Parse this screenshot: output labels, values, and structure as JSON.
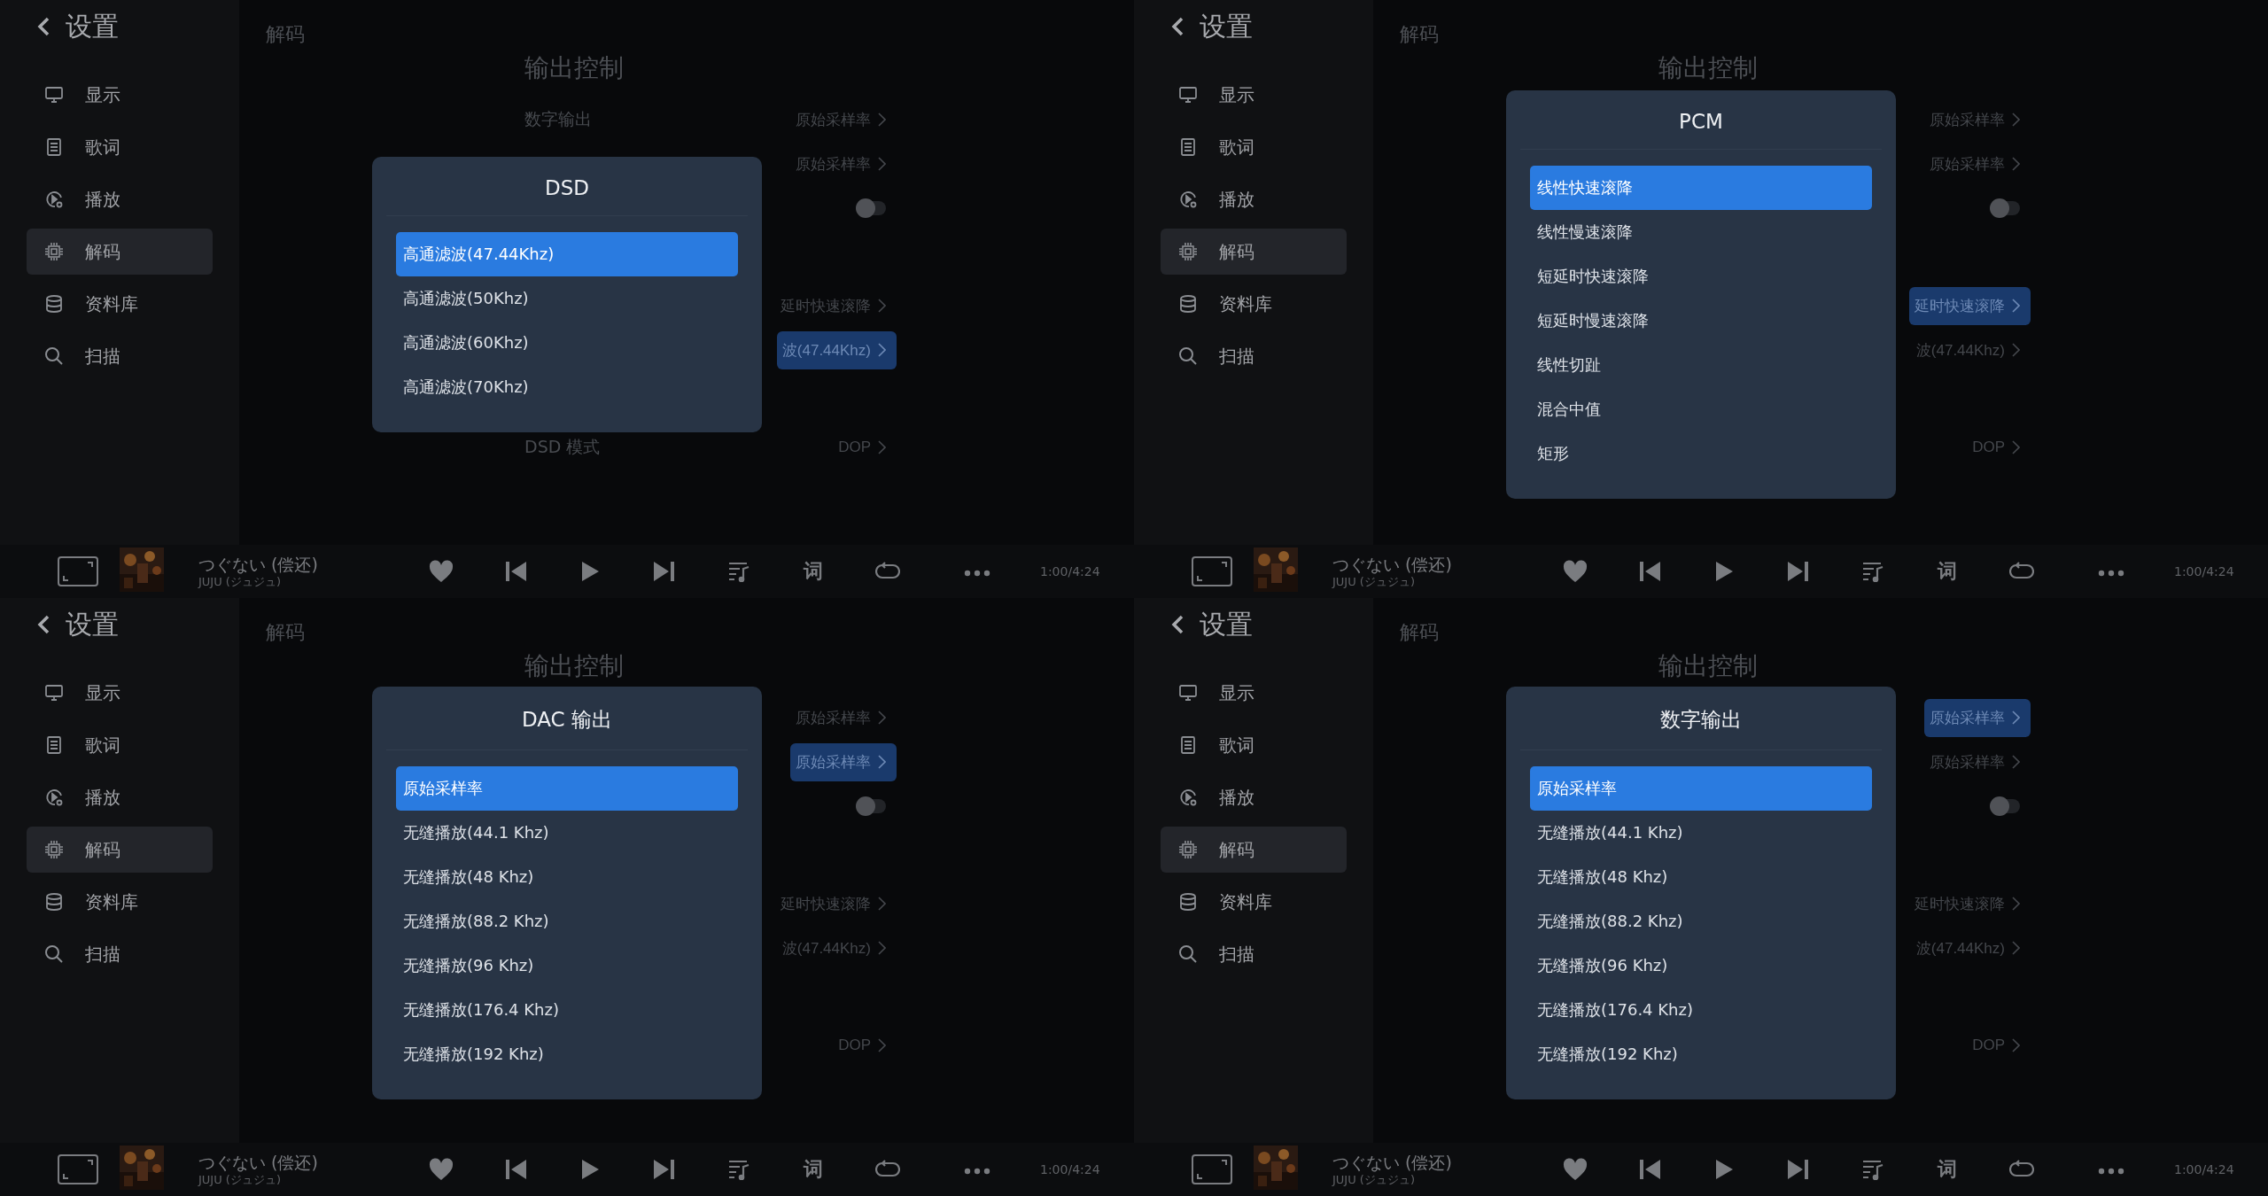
{
  "panels": [
    {
      "sidebar": {
        "title": "设置",
        "items": [
          {
            "label": "显示",
            "selected": false
          },
          {
            "label": "歌词",
            "selected": false
          },
          {
            "label": "播放",
            "selected": false
          },
          {
            "label": "解码",
            "selected": true
          },
          {
            "label": "资料库",
            "selected": false
          },
          {
            "label": "扫描",
            "selected": false
          }
        ]
      },
      "page_title": "解码",
      "section_title": "输出控制",
      "groups": [
        {
          "rows": [
            {
              "kind": "link",
              "label": "数字输出",
              "value": "原始采样率",
              "selected": false
            },
            {
              "kind": "link",
              "value": "原始采样率",
              "selected": false
            },
            {
              "kind": "toggle",
              "on": false,
              "selected": false
            }
          ]
        },
        {
          "rows": [
            {
              "kind": "link",
              "value": "延时快速滚降",
              "selected": false
            },
            {
              "kind": "link",
              "value": "波(47.44Khz)",
              "selected": true
            }
          ]
        },
        {
          "rows": [
            {
              "kind": "link",
              "label": "DSD 模式",
              "value": "DOP",
              "selected": false
            }
          ]
        }
      ],
      "dialog": {
        "title": "DSD",
        "options": [
          {
            "label": "高通滤波(47.44Khz)",
            "selected": true
          },
          {
            "label": "高通滤波(50Khz)",
            "selected": false
          },
          {
            "label": "高通滤波(60Khz)",
            "selected": false
          },
          {
            "label": "高通滤波(70Khz)",
            "selected": false
          }
        ]
      },
      "player": {
        "title": "つぐない (偿还)",
        "artist": "JUJU (ジュジュ)",
        "lyrics_button": "词",
        "time": "1:00/4:24"
      }
    },
    {
      "sidebar": {
        "title": "设置",
        "items": [
          {
            "label": "显示",
            "selected": false
          },
          {
            "label": "歌词",
            "selected": false
          },
          {
            "label": "播放",
            "selected": false
          },
          {
            "label": "解码",
            "selected": true
          },
          {
            "label": "资料库",
            "selected": false
          },
          {
            "label": "扫描",
            "selected": false
          }
        ]
      },
      "page_title": "解码",
      "section_title": "输出控制",
      "groups": [
        {
          "rows": [
            {
              "kind": "link",
              "value": "原始采样率",
              "selected": false
            },
            {
              "kind": "link",
              "value": "原始采样率",
              "selected": false
            },
            {
              "kind": "toggle",
              "on": false,
              "selected": false
            }
          ]
        },
        {
          "rows": [
            {
              "kind": "link",
              "value": "延时快速滚降",
              "selected": true
            },
            {
              "kind": "link",
              "value": "波(47.44Khz)",
              "selected": false
            }
          ]
        },
        {
          "rows": [
            {
              "kind": "link",
              "value": "DOP",
              "selected": false
            }
          ]
        }
      ],
      "dialog": {
        "title": "PCM",
        "options": [
          {
            "label": "线性快速滚降",
            "selected": true
          },
          {
            "label": "线性慢速滚降",
            "selected": false
          },
          {
            "label": "短延时快速滚降",
            "selected": false
          },
          {
            "label": "短延时慢速滚降",
            "selected": false
          },
          {
            "label": "线性切趾",
            "selected": false
          },
          {
            "label": "混合中值",
            "selected": false
          },
          {
            "label": "矩形",
            "selected": false
          }
        ]
      },
      "player": {
        "title": "つぐない (偿还)",
        "artist": "JUJU (ジュジュ)",
        "lyrics_button": "词",
        "time": "1:00/4:24"
      }
    },
    {
      "sidebar": {
        "title": "设置",
        "items": [
          {
            "label": "显示",
            "selected": false
          },
          {
            "label": "歌词",
            "selected": false
          },
          {
            "label": "播放",
            "selected": false
          },
          {
            "label": "解码",
            "selected": true
          },
          {
            "label": "资料库",
            "selected": false
          },
          {
            "label": "扫描",
            "selected": false
          }
        ]
      },
      "page_title": "解码",
      "section_title": "输出控制",
      "groups": [
        {
          "rows": [
            {
              "kind": "link",
              "value": "原始采样率",
              "selected": false
            },
            {
              "kind": "link",
              "value": "原始采样率",
              "selected": true
            },
            {
              "kind": "toggle",
              "on": false,
              "selected": false
            }
          ]
        },
        {
          "rows": [
            {
              "kind": "link",
              "value": "延时快速滚降",
              "selected": false
            },
            {
              "kind": "link",
              "value": "波(47.44Khz)",
              "selected": false
            }
          ]
        },
        {
          "rows": [
            {
              "kind": "link",
              "value": "DOP",
              "selected": false
            }
          ]
        }
      ],
      "dialog": {
        "title": "DAC 输出",
        "options": [
          {
            "label": "原始采样率",
            "selected": true
          },
          {
            "label": "无缝播放(44.1 Khz)",
            "selected": false
          },
          {
            "label": "无缝播放(48 Khz)",
            "selected": false
          },
          {
            "label": "无缝播放(88.2 Khz)",
            "selected": false
          },
          {
            "label": "无缝播放(96 Khz)",
            "selected": false
          },
          {
            "label": "无缝播放(176.4 Khz)",
            "selected": false
          },
          {
            "label": "无缝播放(192 Khz)",
            "selected": false
          }
        ]
      },
      "player": {
        "title": "つぐない (偿还)",
        "artist": "JUJU (ジュジュ)",
        "lyrics_button": "词",
        "time": "1:00/4:24"
      }
    },
    {
      "sidebar": {
        "title": "设置",
        "items": [
          {
            "label": "显示",
            "selected": false
          },
          {
            "label": "歌词",
            "selected": false
          },
          {
            "label": "播放",
            "selected": false
          },
          {
            "label": "解码",
            "selected": true
          },
          {
            "label": "资料库",
            "selected": false
          },
          {
            "label": "扫描",
            "selected": false
          }
        ]
      },
      "page_title": "解码",
      "section_title": "输出控制",
      "groups": [
        {
          "rows": [
            {
              "kind": "link",
              "value": "原始采样率",
              "selected": true
            },
            {
              "kind": "link",
              "value": "原始采样率",
              "selected": false
            },
            {
              "kind": "toggle",
              "on": false,
              "selected": false
            }
          ]
        },
        {
          "rows": [
            {
              "kind": "link",
              "value": "延时快速滚降",
              "selected": false
            },
            {
              "kind": "link",
              "value": "波(47.44Khz)",
              "selected": false
            }
          ]
        },
        {
          "rows": [
            {
              "kind": "link",
              "value": "DOP",
              "selected": false
            }
          ]
        }
      ],
      "dialog": {
        "title": "数字输出",
        "options": [
          {
            "label": "原始采样率",
            "selected": true
          },
          {
            "label": "无缝播放(44.1 Khz)",
            "selected": false
          },
          {
            "label": "无缝播放(48 Khz)",
            "selected": false
          },
          {
            "label": "无缝播放(88.2 Khz)",
            "selected": false
          },
          {
            "label": "无缝播放(96 Khz)",
            "selected": false
          },
          {
            "label": "无缝播放(176.4 Khz)",
            "selected": false
          },
          {
            "label": "无缝播放(192 Khz)",
            "selected": false
          }
        ]
      },
      "player": {
        "title": "つぐない (偿还)",
        "artist": "JUJU (ジュジュ)",
        "lyrics_button": "词",
        "time": "1:00/4:24"
      }
    }
  ]
}
